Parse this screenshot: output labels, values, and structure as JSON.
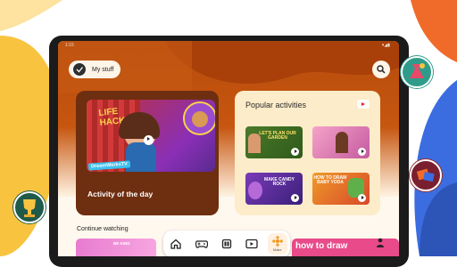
{
  "status": {
    "time": "1:15",
    "icons": "▾◢▮"
  },
  "header": {
    "my_stuff_label": "My stuff",
    "search_icon": "search-icon"
  },
  "activity_of_the_day": {
    "title": "Activity of the day",
    "thumbnail_text": "LIFE HACKS",
    "brand": "DreamWorksTV"
  },
  "popular": {
    "title": "Popular activities",
    "items": [
      {
        "caption": "LET'S PLAN OUR GARDEN"
      },
      {
        "caption": ""
      },
      {
        "caption": "MAKE CANDY ROCK"
      },
      {
        "caption": "HOW TO DRAW BABY YODA"
      }
    ]
  },
  "continue_watching": {
    "title": "Continue watching",
    "peek_text_left": "BE KIND",
    "peek_text_right": "how to draw"
  },
  "nav": {
    "items": [
      {
        "icon": "home-icon"
      },
      {
        "icon": "gamepad-icon"
      },
      {
        "icon": "apps-icon"
      },
      {
        "icon": "video-icon"
      },
      {
        "icon": "make-icon",
        "label": "Make"
      }
    ],
    "profile_icon": "profile-icon"
  },
  "colors": {
    "header": "#b84c0d",
    "aotd_card": "#6e2e10",
    "popular_card": "#fdecc9",
    "accent": "#f29a1c",
    "bg_yellow": "#f8c440",
    "bg_blue": "#3b6de0",
    "bg_orange": "#f06b2a"
  }
}
